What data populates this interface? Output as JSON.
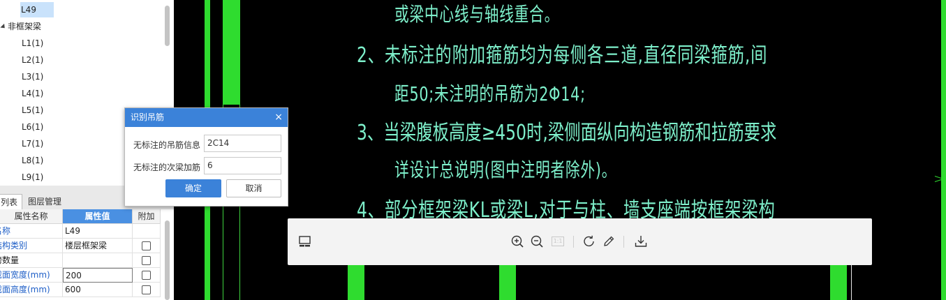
{
  "tree": {
    "selected": "L49",
    "group_label": "非框架梁",
    "items": [
      "L1(1)",
      "L2(1)",
      "L3(1)",
      "L4(1)",
      "L5(1)",
      "L6(1)",
      "L7(1)",
      "L8(1)",
      "L9(1)"
    ]
  },
  "tabs": [
    "列表",
    "图层管理"
  ],
  "props": {
    "headers": [
      "属性名称",
      "属性值",
      "附加"
    ],
    "rows": [
      {
        "name": "名称",
        "value": "L49"
      },
      {
        "name": "结构类别",
        "value": "楼层框架梁"
      },
      {
        "name": "跨数量",
        "value": ""
      },
      {
        "name": "截面宽度(mm)",
        "value": "200"
      },
      {
        "name": "截面高度(mm)",
        "value": "600"
      }
    ]
  },
  "dialog": {
    "title": "识别吊筋",
    "close_glyph": "×",
    "field1_label": "无标注的吊筋信息",
    "field1_value": "2C14",
    "field2_label": "无标注的次梁加筋",
    "field2_value": "6",
    "ok_label": "确定",
    "cancel_label": "取消"
  },
  "notes": [
    "或梁中心线与轴线重合。",
    "2、未标注的附加箍筋均为每侧各三道,直径同梁箍筋,间",
    "距50;未注明的吊筋为2Φ14;",
    "3、当梁腹板高度≥450时,梁侧面纵向构造钢筋和拉筋要求",
    "详设计总说明(图中注明者除外)。",
    "4、部分框架梁KL或梁L,对于与柱、墙支座端按框架梁构"
  ],
  "toolbar": {
    "icons": [
      "thumbnail-icon",
      "zoom-in-icon",
      "zoom-out-icon",
      "actual-size-icon",
      "rotate-icon",
      "edit-icon",
      "download-icon"
    ],
    "actual_size_label": "1:1"
  },
  "colors": {
    "canvas_bg": "#000000",
    "note_text": "#7ef0cb",
    "beam_green": "#2fdc2f",
    "accent": "#3b82d9",
    "prop_name_blue": "#1f5fc7"
  }
}
